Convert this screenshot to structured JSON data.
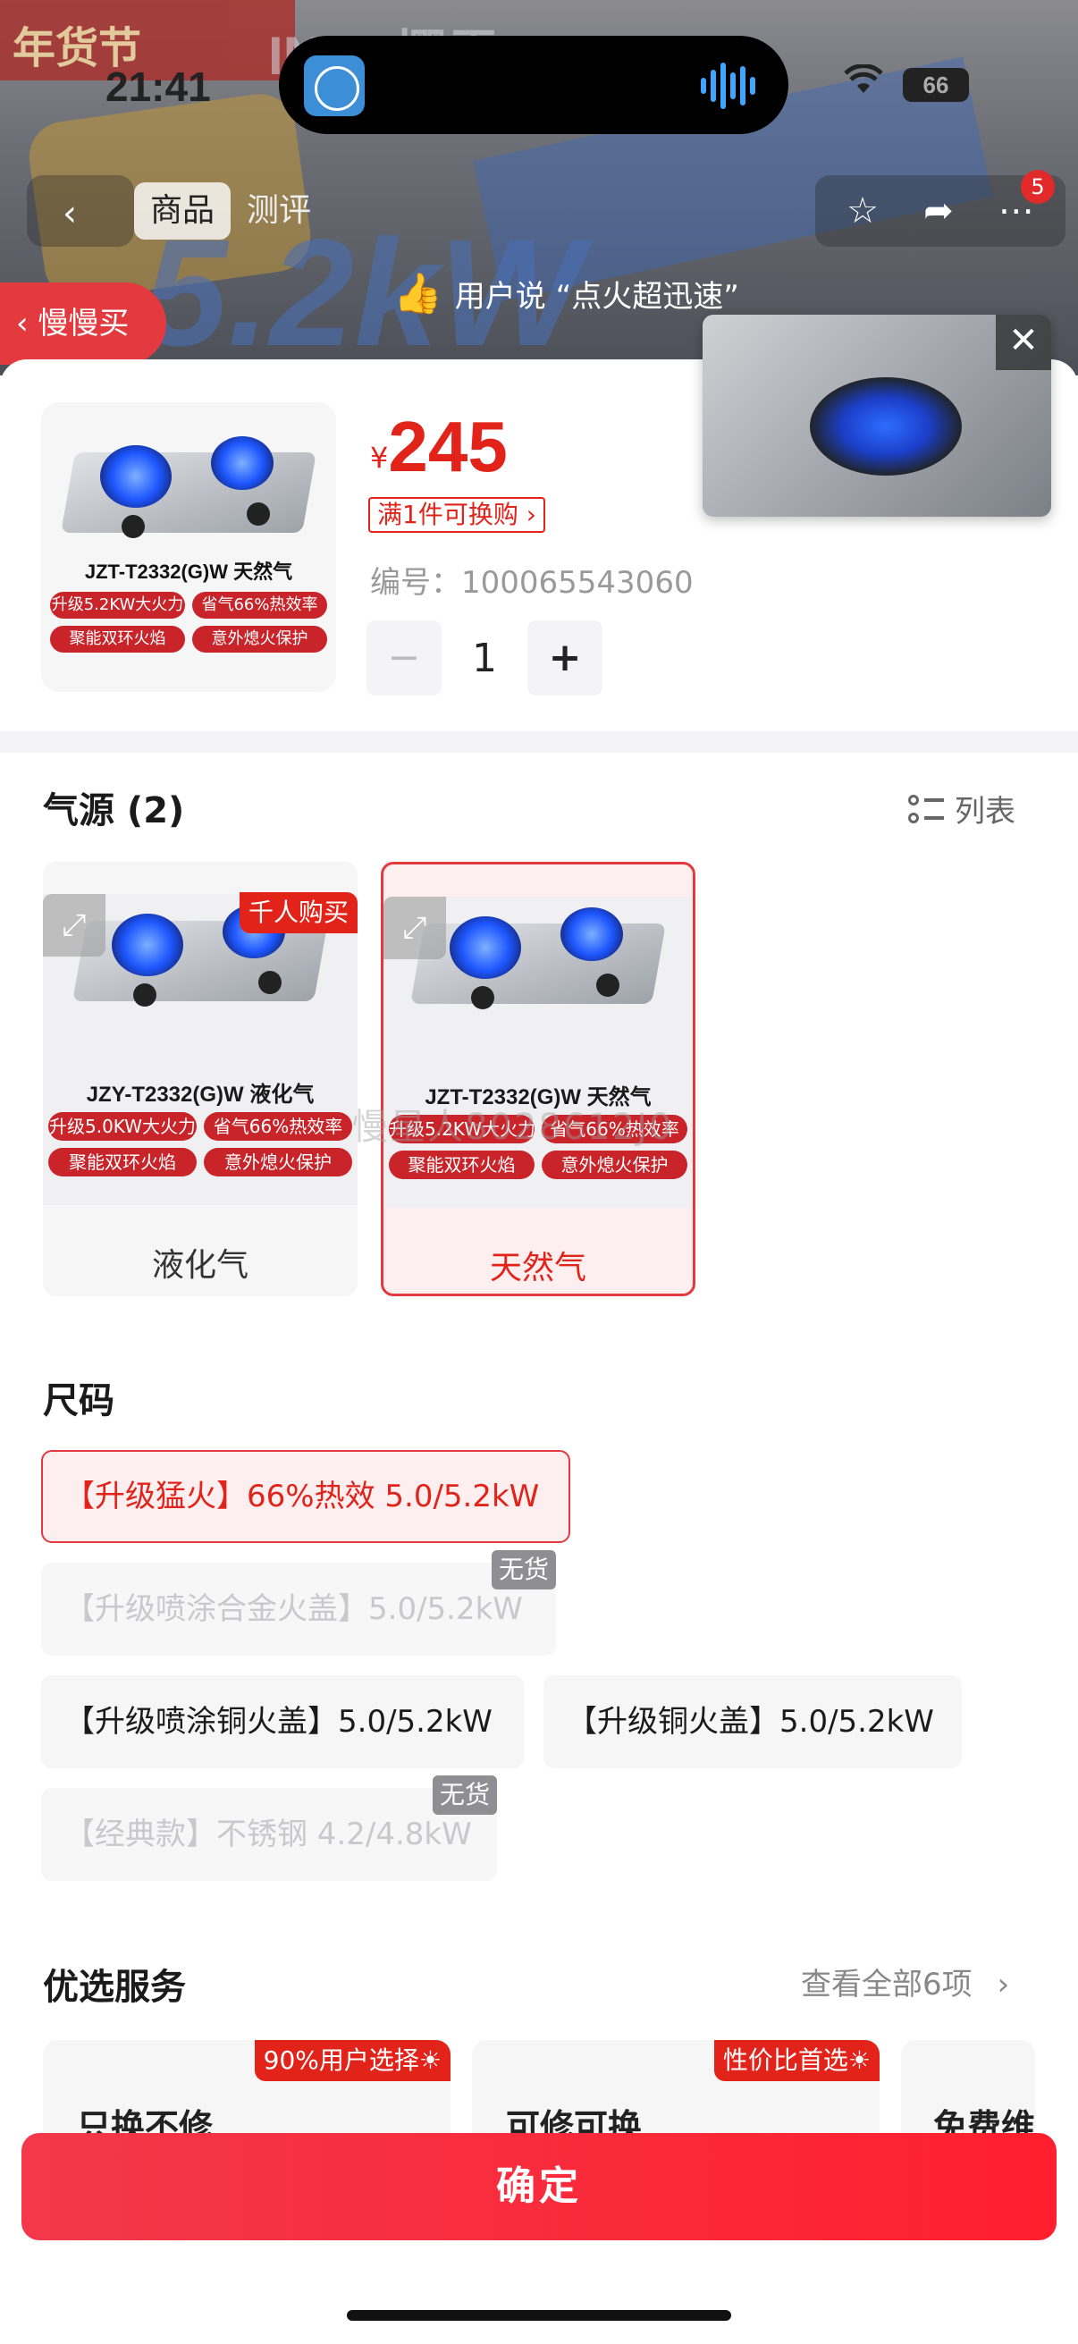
{
  "status_bar": {
    "time": "21:41",
    "battery": "66"
  },
  "nav": {
    "back_icon": "chevron-left-icon",
    "tabs": [
      "商品",
      "测评"
    ],
    "cart_badge": "5"
  },
  "banner": {
    "promo": "年货节",
    "brand": "INSE樱雪",
    "big_text": "5.2kW"
  },
  "review_tip": "用户说 “点火超迅速”",
  "slow_buy": "慢慢买",
  "video_close": "✕",
  "product": {
    "model": "JZT-T2332(G)W 天然气",
    "tags": [
      "升级5.2KW大火力",
      "省气66%热效率",
      "聚能双环火焰",
      "意外熄火保护"
    ],
    "currency": "¥",
    "price": "245",
    "exchange_tag": "满1件可换购",
    "sku_label": "编号：",
    "sku": "100065543060",
    "quantity": "1",
    "minus": "−",
    "plus": "+"
  },
  "gas_source": {
    "title": "气源 (2)",
    "list_toggle": "列表",
    "options": [
      {
        "name": "液化气",
        "model": "JZY-T2332(G)W 液化气",
        "tags": [
          "升级5.0KW大火力",
          "省气66%热效率",
          "聚能双环火焰",
          "意外熄火保护"
        ],
        "badge": "千人购买",
        "selected": false
      },
      {
        "name": "天然气",
        "model": "JZT-T2332(G)W 天然气",
        "tags": [
          "升级5.2KW大火力",
          "省气66%热效率",
          "聚能双环火焰",
          "意外熄火保护"
        ],
        "badge": "",
        "selected": true
      }
    ]
  },
  "watermark": "慢星人8028612J0",
  "size": {
    "title": "尺码",
    "options": [
      {
        "label": "【升级猛火】66%热效 5.0/5.2kW",
        "selected": true,
        "out_of_stock": ""
      },
      {
        "label": "【升级喷涂合金火盖】5.0/5.2kW",
        "selected": false,
        "out_of_stock": "无货"
      },
      {
        "label": "【升级喷涂铜火盖】5.0/5.2kW",
        "selected": false,
        "out_of_stock": ""
      },
      {
        "label": "【升级铜火盖】5.0/5.2kW",
        "selected": false,
        "out_of_stock": ""
      },
      {
        "label": "【经典款】不锈钢 4.2/4.8kW",
        "selected": false,
        "out_of_stock": "无货"
      }
    ]
  },
  "services": {
    "title": "优选服务",
    "view_all": "查看全部6项",
    "items": [
      {
        "title": "只换不修",
        "badge": "90%用户选择☀"
      },
      {
        "title": "可修可换",
        "badge": "性价比首选☀"
      },
      {
        "title": "免费维",
        "badge": ""
      }
    ]
  },
  "confirm": "确定",
  "colors": {
    "accent": "#e2231a",
    "selected_bg": "#fdeff0",
    "tag_red": "#c8242a"
  }
}
